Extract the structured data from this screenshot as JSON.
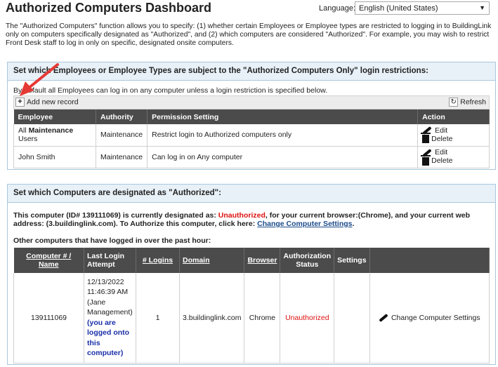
{
  "header": {
    "title": "Authorized Computers Dashboard",
    "language_label": "Language:",
    "language_value": "English (United States)"
  },
  "intro": "The \"Authorized Computers\" function allows you to specify: (1) whether certain Employees or Employee types are restricted to logging in to BuildingLink only on computers specifically designated as \"Authorized\", and (2) which computers are considered \"Authorized\". For example, you may wish to restrict Front Desk staff to log in only on specific, designated onsite computers.",
  "section1": {
    "title": "Set which Employees or Employee Types are subject to the \"Authorized Computers Only\" login restrictions:",
    "default_note": "By default all Employees can log in on any computer unless a login restriction is specified below.",
    "add_label": "Add new record",
    "refresh_label": "Refresh",
    "columns": [
      "Employee",
      "Authority",
      "Permission Setting",
      "Action"
    ],
    "rows": [
      {
        "employee_pre": "All ",
        "employee_bold": "Maintenance",
        "employee_post": " Users",
        "authority": "Maintenance",
        "permission": "Restrict login to Authorized computers only",
        "edit": "Edit",
        "delete": "Delete"
      },
      {
        "employee_pre": "John Smith",
        "employee_bold": "",
        "employee_post": "",
        "authority": "Maintenance",
        "permission": "Can log in on Any computer",
        "edit": "Edit",
        "delete": "Delete"
      }
    ]
  },
  "section2": {
    "title": "Set which Computers are designated as \"Authorized\":",
    "this_computer": {
      "pre": "This computer (ID# 139111069) is currently designated as: ",
      "status": "Unauthorized",
      "post": ", for your current browser:(Chrome), and your current web address: (3.buildinglink.com). To Authorize this computer, click here: ",
      "link": "Change Computer Settings",
      "end": "."
    },
    "others_label": "Other computers that have logged in over the past hour:",
    "columns": {
      "computer": "Computer # / Name",
      "last_login": "Last Login Attempt",
      "logins": "# Logins",
      "domain": "Domain",
      "browser": "Browser",
      "auth_status": "Authorization Status",
      "settings": "Settings"
    },
    "row": {
      "computer": "139111069",
      "last_login_lines": [
        "12/13/2022",
        "11:46:39 AM",
        "(Jane",
        "Management)"
      ],
      "logged_lines": [
        "(you are",
        "logged onto",
        "this",
        "computer)"
      ],
      "logins": "1",
      "domain": "3.buildinglink.com",
      "browser": "Chrome",
      "status": "Unauthorized",
      "action": "Change Computer Settings"
    }
  },
  "colors": {
    "panel_header_bg": "#e8f1f8",
    "table_header_bg": "#4b4b4b",
    "unauthorized": "#dd1111",
    "arrow": "#e53935"
  },
  "icons": [
    "plus-icon",
    "refresh-icon",
    "edit-pen-icon",
    "trash-icon",
    "chevron-down-icon",
    "red-arrow-annotation"
  ]
}
